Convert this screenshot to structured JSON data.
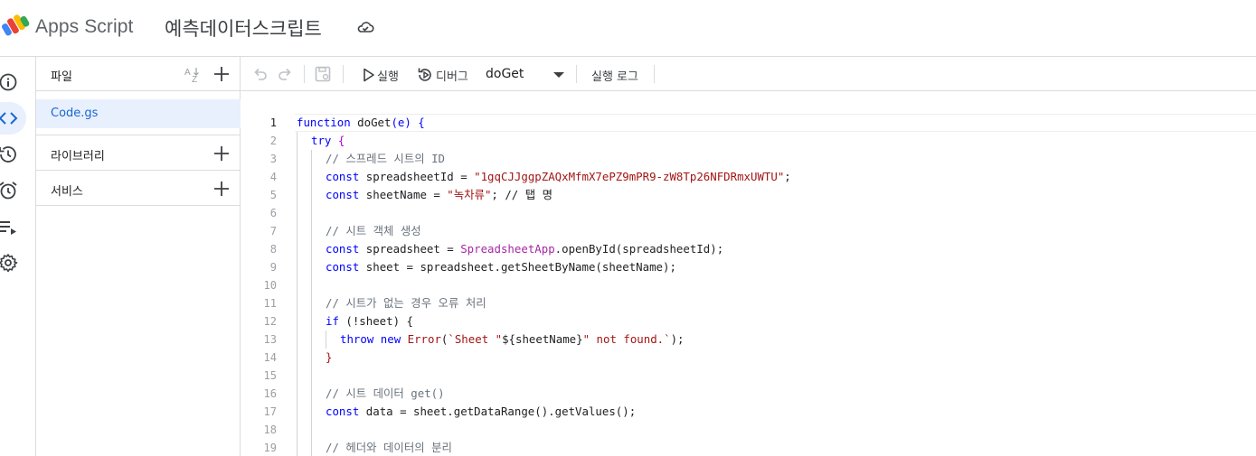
{
  "header": {
    "app_title": "Apps Script",
    "project_title": "예측데이터스크립트"
  },
  "files_panel": {
    "title": "파일",
    "files": [
      "Code.gs"
    ],
    "sections": [
      "라이브러리",
      "서비스"
    ]
  },
  "toolbar": {
    "run_label": "실행",
    "debug_label": "디버그",
    "function_selected": "doGet",
    "log_label": "실행 로그"
  },
  "editor": {
    "current_line": 1,
    "line_numbers": [
      "1",
      "2",
      "3",
      "4",
      "5",
      "6",
      "7",
      "8",
      "9",
      "10",
      "11",
      "12",
      "13",
      "14",
      "15",
      "16",
      "17",
      "18",
      "19"
    ],
    "code": {
      "l1_function": "function",
      "l1_name": " doGet",
      "l1_params": "(e)",
      "l1_brace": " {",
      "l2_try": "try",
      "l2_brace": " {",
      "l3_comment": "// 스프레드 시트의 ID",
      "l4_const": "const",
      "l4_lhs": " spreadsheetId = ",
      "l4_str": "\"1gqCJJggpZAQxMfmX7ePZ9mPR9-zW8Tp26NFDRmxUWTU\"",
      "l4_end": ";",
      "l5_const": "const",
      "l5_lhs": " sheetName = ",
      "l5_str": "\"녹차류\"",
      "l5_end": "; // 탭 명",
      "l7_comment": "// 시트 객체 생성",
      "l8_const": "const",
      "l8_lhs": " spreadsheet = ",
      "l8_cls": "SpreadsheetApp",
      "l8_rest": ".openById(spreadsheetId);",
      "l9_const": "const",
      "l9_rest": " sheet = spreadsheet.getSheetByName(sheetName);",
      "l11_comment": "// 시트가 없는 경우 오류 처리",
      "l12_if": "if",
      "l12_rest": " (!sheet) {",
      "l13_throw": "throw",
      "l13_new": " new",
      "l13_error": " Error",
      "l13_open": "(",
      "l13_tpl1": "`Sheet \"",
      "l13_var": "${sheetName}",
      "l13_tpl2": "\" not found.`",
      "l13_close": ");",
      "l14_brace": "}",
      "l16_comment": "// 시트 데이터 get()",
      "l17_const": "const",
      "l17_rest": " data = sheet.getDataRange().getValues();",
      "l19_comment": "// 헤더와 데이터의 분리"
    }
  },
  "colors": {
    "accent": "#1967d2",
    "selected_bg": "#e8f0fe",
    "keyword": "#0000ff",
    "string": "#a31515",
    "comment": "#6a737d"
  }
}
